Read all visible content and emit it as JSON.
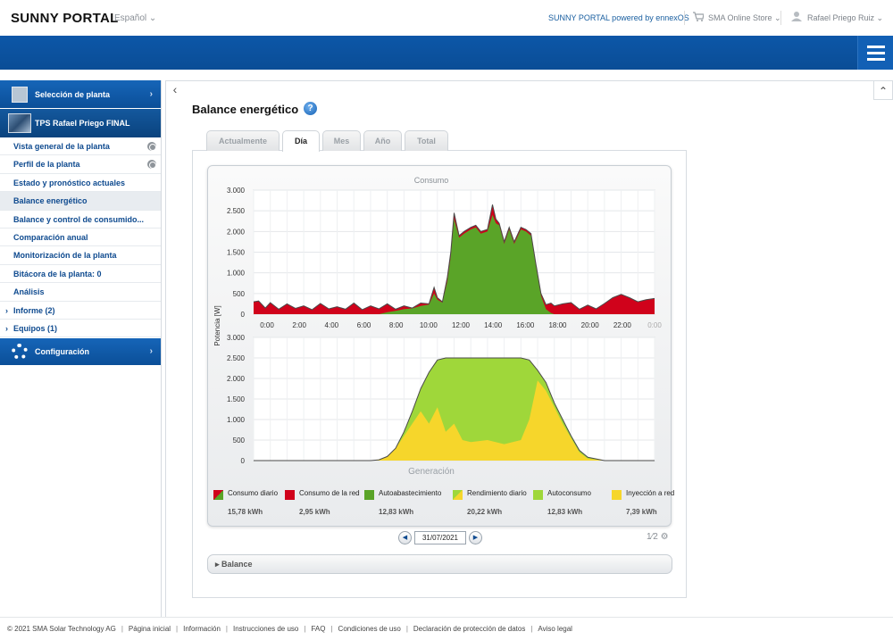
{
  "header": {
    "logo": "SUNNY PORTAL",
    "language": "Español ⌄",
    "powered": "SUNNY PORTAL powered by ennexOS",
    "store": "SMA Online Store ⌄",
    "user": "Rafael Priego Ruiz ⌄"
  },
  "sidebar": {
    "plant_select": "Selección de planta",
    "plant_name": "TPS Rafael Priego FINAL",
    "items": [
      {
        "label": "Vista general de la planta"
      },
      {
        "label": "Perfil de la planta"
      },
      {
        "label": "Estado y pronóstico actuales"
      },
      {
        "label": "Balance energético"
      },
      {
        "label": "Balance y control de consumido..."
      },
      {
        "label": "Comparación anual"
      },
      {
        "label": "Monitorización de la planta"
      },
      {
        "label": "Bitácora de la planta: 0"
      },
      {
        "label": "Análisis"
      },
      {
        "label": "Informe (2)"
      },
      {
        "label": "Equipos (1)"
      }
    ],
    "config": "Configuración"
  },
  "page": {
    "title": "Balance energético",
    "help": "?"
  },
  "tabs": [
    "Actualmente",
    "Día",
    "Mes",
    "Año",
    "Total"
  ],
  "chart_data": {
    "type": "area",
    "top_title": "Consumo",
    "bottom_title": "Generación",
    "ylabel": "Potencia [W]",
    "x_ticks": [
      "0:00",
      "2:00",
      "4:00",
      "6:00",
      "8:00",
      "10:00",
      "12:00",
      "14:00",
      "16:00",
      "18:00",
      "20:00",
      "22:00",
      "0:00"
    ],
    "y_ticks": [
      "3.000",
      "2.500",
      "2.000",
      "1.500",
      "1.000",
      "500",
      "0"
    ],
    "ylim": [
      0,
      3000
    ],
    "consumo": {
      "hours": [
        0,
        0.3,
        0.7,
        1,
        1.5,
        2,
        2.5,
        3,
        3.5,
        4,
        4.5,
        5,
        5.5,
        6,
        6.5,
        7,
        7.5,
        8,
        8.5,
        9,
        9.5,
        10,
        10.5,
        10.8,
        11,
        11.3,
        11.6,
        11.8,
        12,
        12.3,
        12.6,
        13,
        13.3,
        13.6,
        14,
        14.3,
        14.5,
        14.7,
        15,
        15.3,
        15.6,
        16,
        16.3,
        16.6,
        16.9,
        17.2,
        17.5,
        17.8,
        18,
        18.5,
        19,
        19.5,
        20,
        20.5,
        21,
        21.5,
        22,
        22.5,
        23,
        23.5,
        24
      ],
      "total": [
        300,
        320,
        150,
        280,
        120,
        250,
        140,
        200,
        110,
        260,
        130,
        180,
        120,
        270,
        110,
        200,
        130,
        250,
        120,
        200,
        150,
        270,
        250,
        650,
        400,
        300,
        900,
        1500,
        2450,
        1900,
        2000,
        2100,
        2150,
        2000,
        2050,
        2650,
        2300,
        2200,
        1750,
        2100,
        1750,
        2100,
        2050,
        1950,
        1200,
        500,
        230,
        270,
        200,
        250,
        280,
        120,
        220,
        130,
        260,
        400,
        480,
        400,
        300,
        350,
        380
      ],
      "autoabastecimiento": [
        0,
        0,
        0,
        0,
        0,
        0,
        0,
        0,
        0,
        0,
        0,
        0,
        0,
        0,
        0,
        0,
        0,
        50,
        80,
        120,
        140,
        200,
        230,
        500,
        350,
        280,
        800,
        1400,
        2300,
        1850,
        1950,
        2050,
        2100,
        1950,
        2000,
        2400,
        2200,
        2150,
        1700,
        2050,
        1700,
        2050,
        2000,
        1900,
        1150,
        450,
        120,
        30,
        0,
        0,
        0,
        0,
        0,
        0,
        0,
        0,
        0,
        0,
        0,
        0,
        0
      ]
    },
    "generacion": {
      "hours": [
        0,
        7,
        7.5,
        8,
        8.5,
        9,
        9.5,
        10,
        10.5,
        11,
        11.5,
        12,
        12.5,
        13,
        14,
        15,
        16,
        16.5,
        17,
        17.5,
        18,
        18.5,
        19,
        19.5,
        20,
        21,
        24
      ],
      "total": [
        0,
        0,
        20,
        100,
        300,
        700,
        1200,
        1750,
        2150,
        2450,
        2500,
        2500,
        2500,
        2500,
        2500,
        2500,
        2500,
        2450,
        2200,
        1900,
        1400,
        1000,
        600,
        250,
        80,
        0,
        0
      ],
      "inyeccion": [
        0,
        0,
        20,
        100,
        300,
        600,
        900,
        1200,
        900,
        1300,
        700,
        900,
        500,
        450,
        500,
        400,
        500,
        1000,
        1950,
        1700,
        1300,
        900,
        550,
        200,
        50,
        0,
        0
      ]
    },
    "legend": [
      {
        "label": "Consumo diario",
        "value": "15,78 kWh",
        "color": "split-red-green"
      },
      {
        "label": "Consumo de la red",
        "value": "2,95 kWh",
        "color": "#d0021b"
      },
      {
        "label": "Autoabastecimiento",
        "value": "12,83 kWh",
        "color": "#5aa428"
      },
      {
        "label": "Rendimiento diario",
        "value": "20,22 kWh",
        "color": "split-green-yellow"
      },
      {
        "label": "Autoconsumo",
        "value": "12,83 kWh",
        "color": "#9fd73a"
      },
      {
        "label": "Inyección a red",
        "value": "7,39 kWh",
        "color": "#f6d62b"
      }
    ]
  },
  "date": {
    "value": "31/07/2021",
    "prev": "◀",
    "next": "▶"
  },
  "tools": "1⁄2 ⚙",
  "balance": "Balance",
  "footer": {
    "items": [
      "© 2021 SMA Solar Technology AG",
      "Página inicial",
      "Información",
      "Instrucciones de uso",
      "FAQ",
      "Condiciones de uso",
      "Declaración de protección de datos",
      "Aviso legal"
    ]
  },
  "colors": {
    "brand_blue": "#0d57a8",
    "red": "#d0021b",
    "green": "#5aa428",
    "light_green": "#9fd73a",
    "yellow": "#f6d62b"
  }
}
